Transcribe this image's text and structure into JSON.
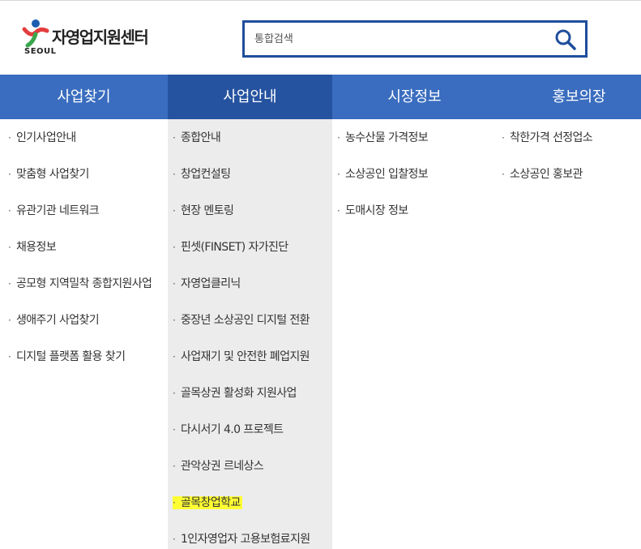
{
  "header": {
    "logo_text": "자영업지원센터",
    "logo_sub": "SEOUL",
    "search_placeholder": "통합검색"
  },
  "colors": {
    "nav_bg": "#3a6dbf",
    "nav_active": "#2653a0",
    "search_border": "#1f4e9c",
    "highlight": "#ffff33"
  },
  "nav": [
    {
      "label": "사업찾기"
    },
    {
      "label": "사업안내"
    },
    {
      "label": "시장정보"
    },
    {
      "label": "홍보의장"
    }
  ],
  "menus": {
    "col1": [
      "인기사업안내",
      "맞춤형 사업찾기",
      "유관기관 네트워크",
      "채용정보",
      "공모형 지역밀착 종합지원사업",
      "생애주기 사업찾기",
      "디지털 플랫폼 활용 찾기"
    ],
    "col2": [
      "종합안내",
      "창업컨설팅",
      "현장 멘토링",
      "핀셋(FINSET) 자가진단",
      "자영업클리닉",
      "중장년 소상공인 디지털 전환",
      "사업재기 및 안전한 폐업지원",
      "골목상권 활성화 지원사업",
      "다시서기 4.0 프로젝트",
      "관악상권 르네상스",
      "골목창업학교",
      "1인자영업자 고용보험료지원"
    ],
    "col3": [
      "농수산물 가격정보",
      "소상공인 입찰정보",
      "도매시장 정보"
    ],
    "col4": [
      "착한가격 선정업소",
      "소상공인 홍보관"
    ]
  }
}
